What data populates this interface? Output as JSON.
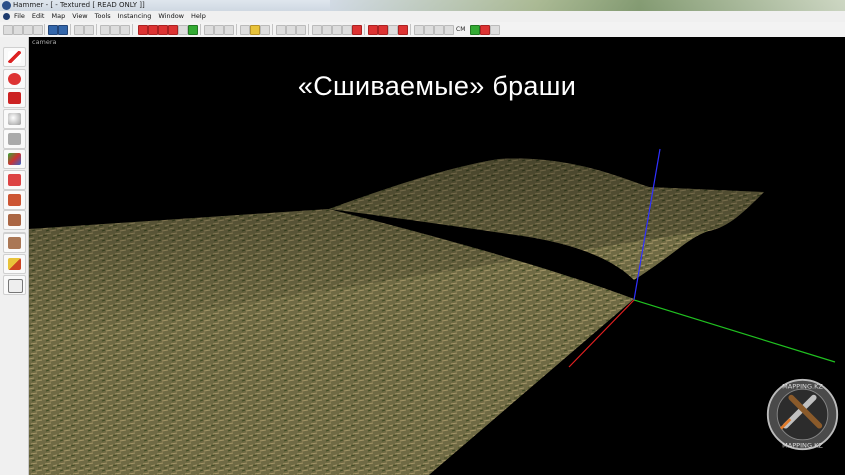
{
  "window": {
    "title": "Hammer - [ - Textured [ READ ONLY ]]"
  },
  "menu": {
    "items": [
      "File",
      "Edit",
      "Map",
      "View",
      "Tools",
      "Instancing",
      "Window",
      "Help"
    ]
  },
  "toolbar": {
    "cm_label": "CM"
  },
  "viewport": {
    "label": "camera",
    "caption": "«Сшиваемые» браши"
  },
  "colors": {
    "axis_x": "#e02020",
    "axis_y": "#20c020",
    "axis_z": "#3030ff",
    "grass_light": "#8a7d55",
    "grass_dark": "#4e5a2a"
  },
  "watermark": {
    "text_top": "MAPPING KZ",
    "text_bottom": "MAPPING.KZ"
  }
}
